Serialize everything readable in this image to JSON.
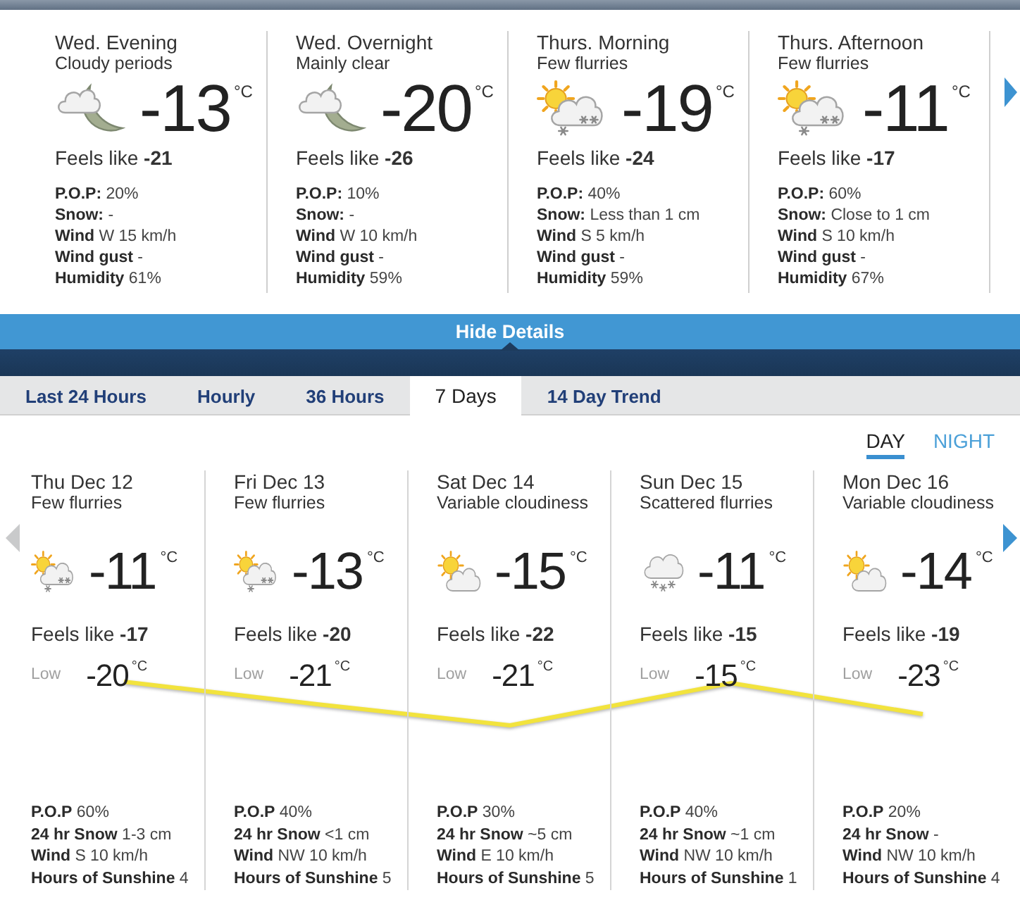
{
  "periods": [
    {
      "title": "Wed. Evening",
      "condition": "Cloudy periods",
      "kind": "cloudynight",
      "temperature": "-13",
      "unit": "°C",
      "feels_like_label": "Feels like",
      "feels_like": "-21",
      "details": [
        "**P.O.P:** 20%",
        "**Snow:** -",
        "**Wind** W 15 km/h",
        "**Wind gust** -",
        "**Humidity** 61%"
      ]
    },
    {
      "title": "Wed. Overnight",
      "condition": "Mainly clear",
      "kind": "cloudynight",
      "temperature": "-20",
      "unit": "°C",
      "feels_like_label": "Feels like",
      "feels_like": "-26",
      "details": [
        "**P.O.P:** 10%",
        "**Snow:** -",
        "**Wind** W 10 km/h",
        "**Wind gust** -",
        "**Humidity** 59%"
      ]
    },
    {
      "title": "Thurs. Morning",
      "condition": "Few flurries",
      "kind": "flurries",
      "temperature": "-19",
      "unit": "°C",
      "feels_like_label": "Feels like",
      "feels_like": "-24",
      "details": [
        "**P.O.P:** 40%",
        "**Snow:** Less than 1 cm",
        "**Wind** S 5 km/h",
        "**Wind gust** -",
        "**Humidity** 59%"
      ]
    },
    {
      "title": "Thurs. Afternoon",
      "condition": "Few flurries",
      "kind": "flurries",
      "temperature": "-11",
      "unit": "°C",
      "feels_like_label": "Feels like",
      "feels_like": "-17",
      "details": [
        "**P.O.P:** 60%",
        "**Snow:** Close to 1 cm",
        "**Wind** S 10 km/h",
        "**Wind gust** -",
        "**Humidity** 67%"
      ]
    }
  ],
  "hide_details": "Hide Details",
  "tabs": [
    {
      "label": "Last 24 Hours",
      "selected": false
    },
    {
      "label": "Hourly",
      "selected": false
    },
    {
      "label": "36 Hours",
      "selected": false
    },
    {
      "label": "7 Days",
      "selected": true
    },
    {
      "label": "14 Day Trend",
      "selected": false
    }
  ],
  "day_night": [
    {
      "label": "DAY",
      "selected": true
    },
    {
      "label": "NIGHT",
      "selected": false
    }
  ],
  "days": [
    {
      "title": "Thu Dec 12",
      "condition": "Few flurries",
      "kind": "flurries",
      "temperature": "-11",
      "unit": "°C",
      "feels_like_label": "Feels like",
      "feels_like": "-17",
      "low_label": "Low",
      "low": "-20",
      "low_unit": "°C",
      "details": [
        "**P.O.P** 60%",
        "**24 hr Snow** 1-3 cm",
        "**Wind** S 10 km/h",
        "**Hours of Sunshine** 4"
      ]
    },
    {
      "title": "Fri Dec 13",
      "condition": "Few flurries",
      "kind": "flurries",
      "temperature": "-13",
      "unit": "°C",
      "feels_like_label": "Feels like",
      "feels_like": "-20",
      "low_label": "Low",
      "low": "-21",
      "low_unit": "°C",
      "details": [
        "**P.O.P** 40%",
        "**24 hr Snow** <1 cm",
        "**Wind** NW 10 km/h",
        "**Hours of Sunshine** 5"
      ]
    },
    {
      "title": "Sat Dec 14",
      "condition": "Variable cloudiness",
      "kind": "suncloud",
      "temperature": "-15",
      "unit": "°C",
      "feels_like_label": "Feels like",
      "feels_like": "-22",
      "low_label": "Low",
      "low": "-21",
      "low_unit": "°C",
      "details": [
        "**P.O.P** 30%",
        "**24 hr Snow** ~5 cm",
        "**Wind** E 10 km/h",
        "**Hours of Sunshine** 5"
      ]
    },
    {
      "title": "Sun Dec 15",
      "condition": "Scattered flurries",
      "kind": "snow",
      "temperature": "-11",
      "unit": "°C",
      "feels_like_label": "Feels like",
      "feels_like": "-15",
      "low_label": "Low",
      "low": "-15",
      "low_unit": "°C",
      "details": [
        "**P.O.P** 40%",
        "**24 hr Snow** ~1 cm",
        "**Wind** NW 10 km/h",
        "**Hours of Sunshine** 1"
      ]
    },
    {
      "title": "Mon Dec 16",
      "condition": "Variable cloudiness",
      "kind": "suncloud",
      "temperature": "-14",
      "unit": "°C",
      "feels_like_label": "Feels like",
      "feels_like": "-19",
      "low_label": "Low",
      "low": "-23",
      "low_unit": "°C",
      "details": [
        "**P.O.P** 20%",
        "**24 hr Snow** -",
        "**Wind** NW 10 km/h",
        "**Hours of Sunshine** 4"
      ]
    }
  ]
}
